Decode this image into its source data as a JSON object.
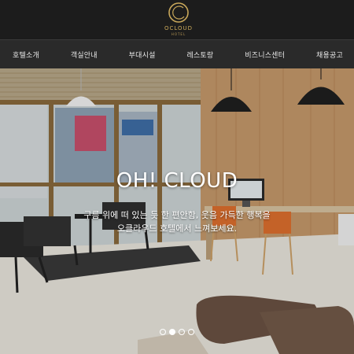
{
  "brand": {
    "name": "OCLOUD",
    "sub": "HOTEL",
    "gold": "#c8a75a"
  },
  "nav": {
    "items": [
      {
        "label": "호텔소개"
      },
      {
        "label": "객실안내"
      },
      {
        "label": "부대시설"
      },
      {
        "label": "레스토랑"
      },
      {
        "label": "비즈니스센터"
      },
      {
        "label": "채용공고"
      }
    ]
  },
  "hero": {
    "headline": "OH! CLOUD",
    "tagline_line1": "구름 위에 떠 있는 듯 한 편안함, 웃음 가득한 행복을",
    "tagline_line2": "오클라우드 호텔에서 느껴보세요.",
    "slide_count": 4,
    "active_slide": 2
  }
}
